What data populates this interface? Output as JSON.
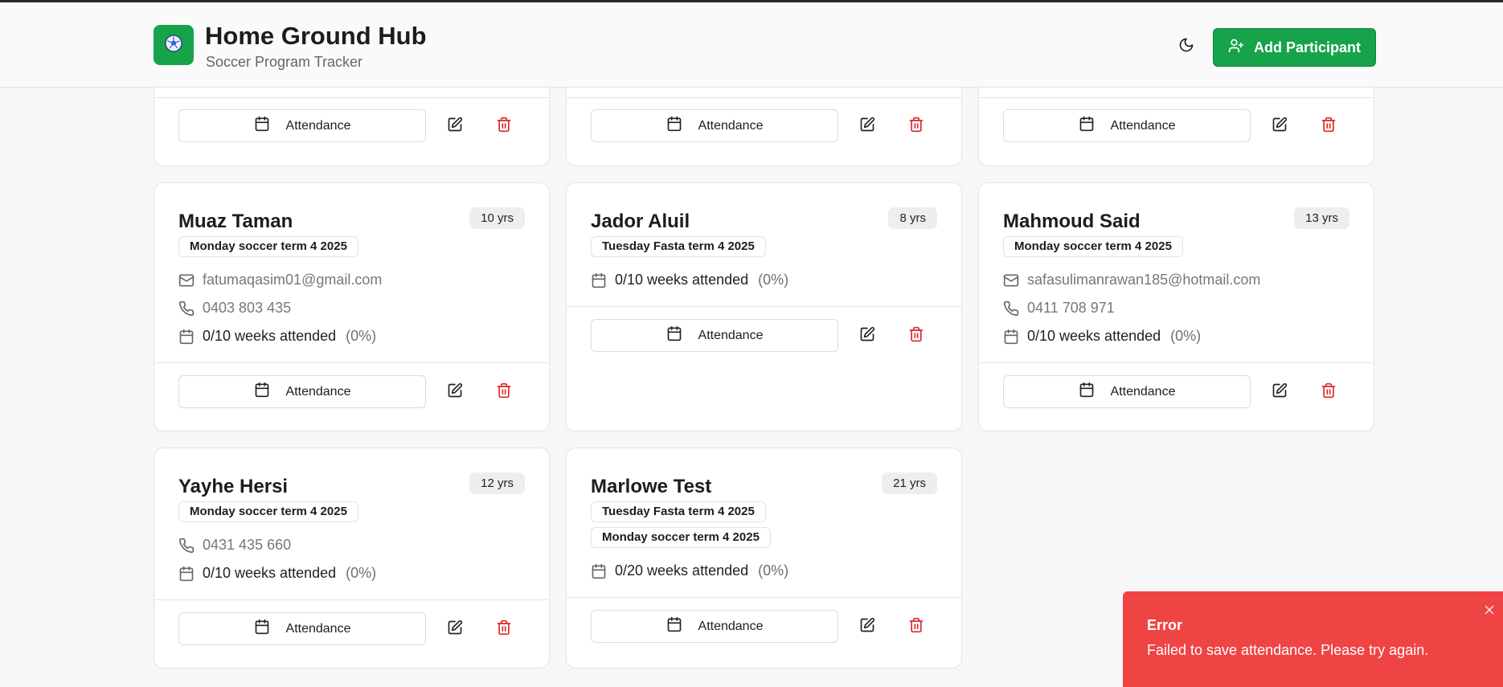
{
  "header": {
    "title": "Home Ground Hub",
    "subtitle": "Soccer Program Tracker",
    "add_button_label": "Add Participant",
    "logo_icon": "soccer-ball-icon",
    "theme_icon": "moon-icon"
  },
  "common": {
    "attendance_label": "Attendance",
    "weeks_attended_text": "weeks attended"
  },
  "cards": [
    {
      "name": "",
      "age": "",
      "programs": [],
      "email": "",
      "phone": "",
      "attended": "",
      "pct": ""
    },
    {
      "name": "",
      "age": "",
      "programs": [],
      "email": "",
      "phone": "",
      "attended": "",
      "pct": ""
    },
    {
      "name": "",
      "age": "",
      "programs": [],
      "email": "",
      "phone": "",
      "attended": "",
      "pct": ""
    },
    {
      "name": "Muaz Taman",
      "age": "10 yrs",
      "programs": [
        "Monday soccer term 4 2025"
      ],
      "email": "fatumaqasim01@gmail.com",
      "phone": "0403 803 435",
      "attended": "0/10 weeks attended",
      "pct": "(0%)"
    },
    {
      "name": "Jador Aluil",
      "age": "8 yrs",
      "programs": [
        "Tuesday Fasta term 4 2025"
      ],
      "email": "",
      "phone": "",
      "attended": "0/10 weeks attended",
      "pct": "(0%)"
    },
    {
      "name": "Mahmoud Said",
      "age": "13 yrs",
      "programs": [
        "Monday soccer term 4 2025"
      ],
      "email": "safasulimanrawan185@hotmail.com",
      "phone": "0411 708 971",
      "attended": "0/10 weeks attended",
      "pct": "(0%)"
    },
    {
      "name": "Yayhe Hersi",
      "age": "12 yrs",
      "programs": [
        "Monday soccer term 4 2025"
      ],
      "email": "",
      "phone": "0431 435 660",
      "attended": "0/10 weeks attended",
      "pct": "(0%)"
    },
    {
      "name": "Marlowe Test",
      "age": "21 yrs",
      "programs": [
        "Tuesday Fasta term 4 2025",
        "Monday soccer term 4 2025"
      ],
      "email": "",
      "phone": "",
      "attended": "0/20 weeks attended",
      "pct": "(0%)"
    }
  ],
  "toast": {
    "title": "Error",
    "message": "Failed to save attendance. Please try again."
  },
  "colors": {
    "brand": "#16a34a",
    "danger": "#ef4444",
    "delete_icon": "#dc2626"
  }
}
